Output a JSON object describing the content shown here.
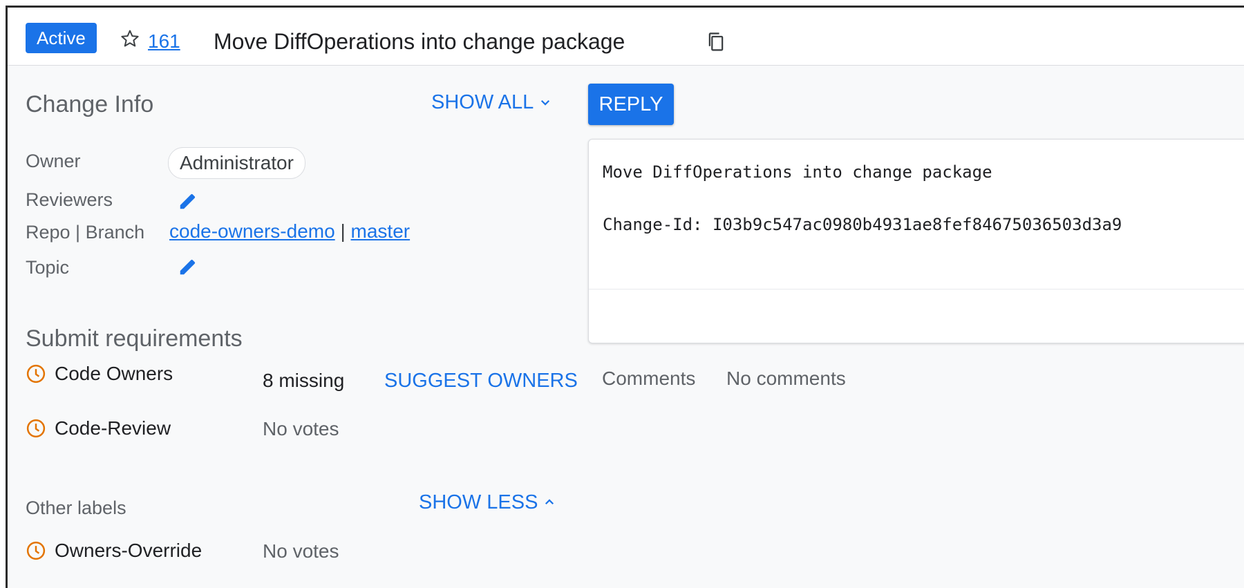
{
  "header": {
    "status": "Active",
    "star_count": "161",
    "subject": "Move DiffOperations into change package",
    "icons": {
      "star": "star-outline-icon",
      "copy": "copy-icon"
    },
    "accent_color": "#1a73e8"
  },
  "change_info": {
    "title": "Change Info",
    "show_all": "SHOW ALL",
    "owner_label": "Owner",
    "owner_value": "Administrator",
    "reviewers_label": "Reviewers",
    "repo_branch_label": "Repo | Branch",
    "repo": "code-owners-demo",
    "separator": "|",
    "branch": "master",
    "topic_label": "Topic"
  },
  "submit_requirements": {
    "title": "Submit requirements",
    "items": [
      {
        "name": "Code Owners",
        "value": "8 missing",
        "action": "SUGGEST OWNERS"
      },
      {
        "name": "Code-Review",
        "value": "No votes"
      }
    ],
    "status_color": "#e37400"
  },
  "other_labels": {
    "title": "Other labels",
    "show_less": "SHOW LESS",
    "items": [
      {
        "name": "Owners-Override",
        "value": "No votes"
      }
    ]
  },
  "reply": {
    "label": "REPLY"
  },
  "commit_message": {
    "line1": "Move DiffOperations into change package",
    "line2": "Change-Id: I03b9c547ac0980b4931ae8fef84675036503d3a9"
  },
  "comments": {
    "label": "Comments",
    "value": "No comments"
  }
}
